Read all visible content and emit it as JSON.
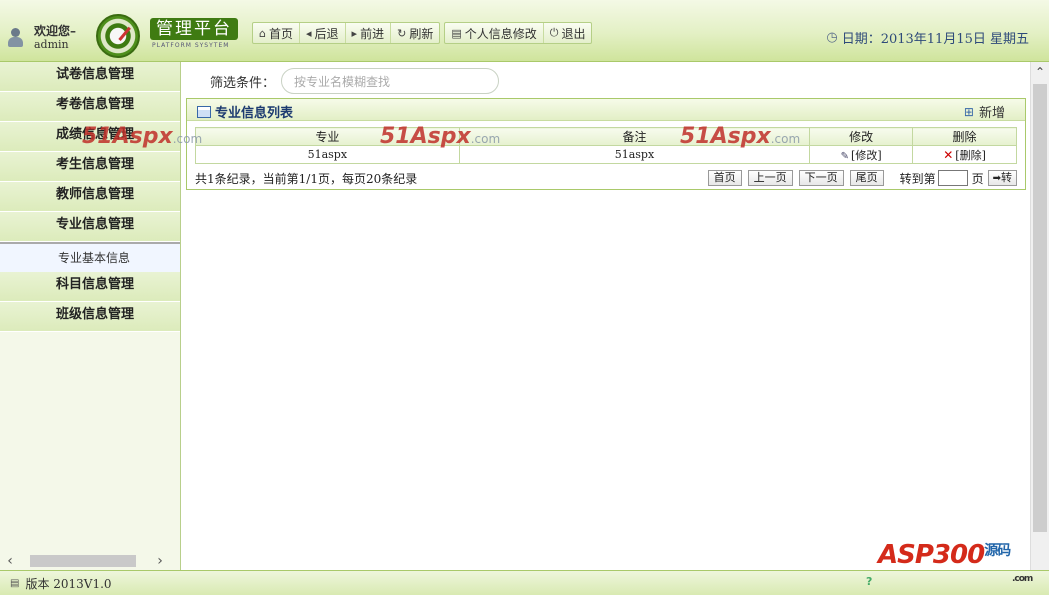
{
  "header": {
    "welcome": "欢迎您–",
    "username": "admin",
    "logo_title": "管理平台",
    "logo_subtitle": "PLATFORM SYSYTEM",
    "toolbar_nav": [
      {
        "icon": "home-icon",
        "glyph": "⌂",
        "label": "首页"
      },
      {
        "icon": "back-icon",
        "glyph": "◂",
        "label": "后退"
      },
      {
        "icon": "forward-icon",
        "glyph": "▸",
        "label": "前进"
      },
      {
        "icon": "refresh-icon",
        "glyph": "↻",
        "label": "刷新"
      }
    ],
    "toolbar_user": [
      {
        "icon": "profile-icon",
        "glyph": "▤",
        "label": "个人信息修改"
      },
      {
        "icon": "power-icon",
        "glyph": "⏻",
        "label": "退出"
      }
    ],
    "date_text": "日期：2013年11月15日 星期五"
  },
  "sidebar": {
    "items_top": [
      "试卷信息管理",
      "考卷信息管理",
      "成绩信息管理",
      "考生信息管理",
      "教师信息管理",
      "专业信息管理"
    ],
    "sub_item": "专业基本信息",
    "items_bottom": [
      "科目信息管理",
      "班级信息管理"
    ]
  },
  "filter": {
    "label": "筛选条件：",
    "placeholder": "按专业名模糊查找"
  },
  "panel": {
    "title": "专业信息列表",
    "add_label": "新增",
    "columns": [
      "专业",
      "备注",
      "修改",
      "删除"
    ],
    "rows": [
      {
        "major": "51aspx",
        "remark": "51aspx",
        "edit": "[修改]",
        "delete": "[删除]"
      }
    ]
  },
  "pager": {
    "info": "共1条纪录，当前第1/1页，每页20条纪录",
    "first": "首页",
    "prev": "上一页",
    "next": "下一页",
    "last": "尾页",
    "jump_label": "转到第",
    "page_unit": "页",
    "go": "转"
  },
  "watermark": {
    "text": "51Aspx",
    "suffix": ".com"
  },
  "footer": {
    "version": "版本 2013V1.0",
    "brand": "ASP300",
    "brand_zh": "源码",
    "brand_domain": ".com"
  },
  "colors": {
    "accent_green": "#3f7b12",
    "title_blue": "#1c3a70",
    "delete_red": "#cc0000"
  }
}
